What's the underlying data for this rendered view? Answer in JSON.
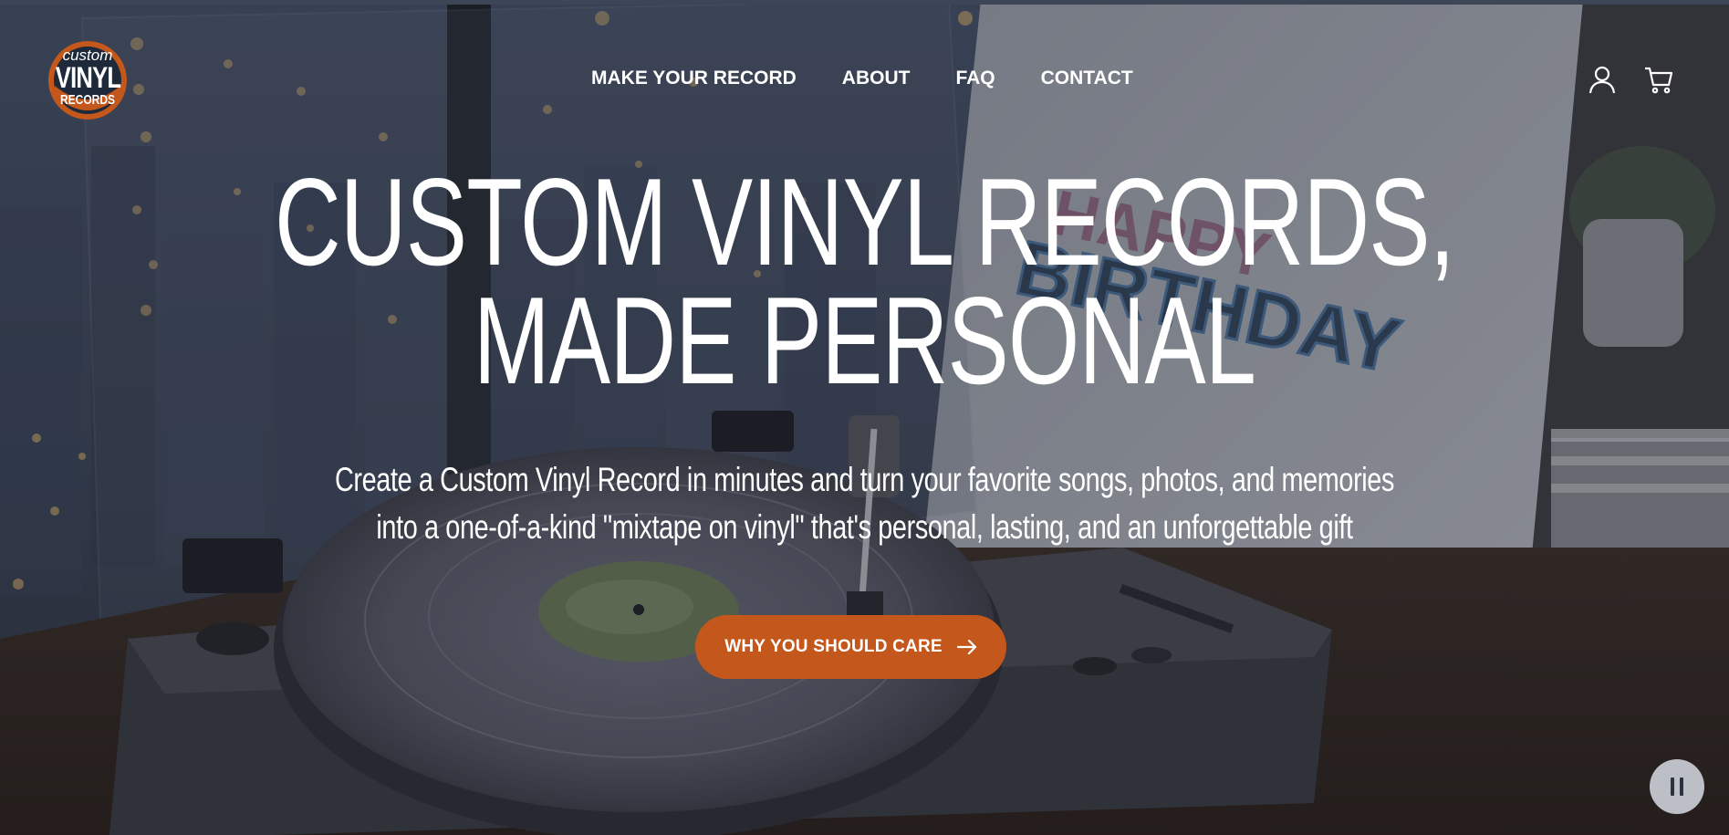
{
  "brand": {
    "logo_line1": "custom",
    "logo_line2": "VINYL",
    "logo_line3": "RECORDS",
    "accent": "#c4571b"
  },
  "nav": {
    "items": [
      {
        "label": "MAKE YOUR RECORD"
      },
      {
        "label": "ABOUT"
      },
      {
        "label": "FAQ"
      },
      {
        "label": "CONTACT"
      }
    ]
  },
  "header_icons": {
    "account": "user-icon",
    "cart": "cart-icon"
  },
  "hero": {
    "headline_line1": "CUSTOM VINYL RECORDS,",
    "headline_line2": "MADE PERSONAL",
    "subtext_line1": "Create a Custom Vinyl Record in minutes and turn your favorite songs, photos, and memories",
    "subtext_line2": "into a one-of-a-kind \"mixtape on vinyl\" that's personal, lasting, and an unforgettable gift",
    "cta_label": "WHY YOU SHOULD CARE",
    "background_card_text_1": "HAPPY",
    "background_card_text_2": "BIRTHDAY"
  },
  "video_control": {
    "icon": "pause-icon"
  }
}
